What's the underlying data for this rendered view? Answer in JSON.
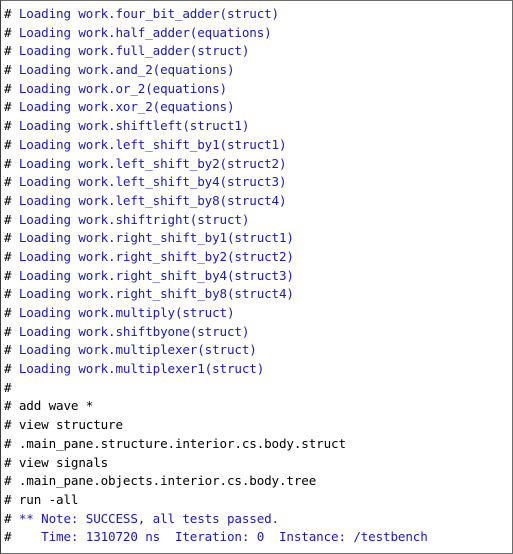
{
  "window": {
    "name": "Transcript"
  },
  "colors": {
    "loading_text": "#1a1ab4",
    "command_text": "#000000",
    "note_text": "#1a1ab4",
    "background": "#ffffff"
  },
  "transcript": {
    "lines": [
      {
        "prefix": "#",
        "text": " Loading work.four_bit_adder(struct)",
        "kind": "load"
      },
      {
        "prefix": "#",
        "text": " Loading work.half_adder(equations)",
        "kind": "load"
      },
      {
        "prefix": "#",
        "text": " Loading work.full_adder(struct)",
        "kind": "load"
      },
      {
        "prefix": "#",
        "text": " Loading work.and_2(equations)",
        "kind": "load"
      },
      {
        "prefix": "#",
        "text": " Loading work.or_2(equations)",
        "kind": "load"
      },
      {
        "prefix": "#",
        "text": " Loading work.xor_2(equations)",
        "kind": "load"
      },
      {
        "prefix": "#",
        "text": " Loading work.shiftleft(struct1)",
        "kind": "load"
      },
      {
        "prefix": "#",
        "text": " Loading work.left_shift_by1(struct1)",
        "kind": "load"
      },
      {
        "prefix": "#",
        "text": " Loading work.left_shift_by2(struct2)",
        "kind": "load"
      },
      {
        "prefix": "#",
        "text": " Loading work.left_shift_by4(struct3)",
        "kind": "load"
      },
      {
        "prefix": "#",
        "text": " Loading work.left_shift_by8(struct4)",
        "kind": "load"
      },
      {
        "prefix": "#",
        "text": " Loading work.shiftright(struct)",
        "kind": "load"
      },
      {
        "prefix": "#",
        "text": " Loading work.right_shift_by1(struct1)",
        "kind": "load"
      },
      {
        "prefix": "#",
        "text": " Loading work.right_shift_by2(struct2)",
        "kind": "load"
      },
      {
        "prefix": "#",
        "text": " Loading work.right_shift_by4(struct3)",
        "kind": "load"
      },
      {
        "prefix": "#",
        "text": " Loading work.right_shift_by8(struct4)",
        "kind": "load"
      },
      {
        "prefix": "#",
        "text": " Loading work.multiply(struct)",
        "kind": "load"
      },
      {
        "prefix": "#",
        "text": " Loading work.shiftbyone(struct)",
        "kind": "load"
      },
      {
        "prefix": "#",
        "text": " Loading work.multiplexer(struct)",
        "kind": "load"
      },
      {
        "prefix": "#",
        "text": " Loading work.multiplexer1(struct)",
        "kind": "load"
      },
      {
        "prefix": "#",
        "text": "",
        "kind": "cmd"
      },
      {
        "prefix": "#",
        "text": " add wave *",
        "kind": "cmd"
      },
      {
        "prefix": "#",
        "text": " view structure",
        "kind": "cmd"
      },
      {
        "prefix": "#",
        "text": " .main_pane.structure.interior.cs.body.struct",
        "kind": "cmd"
      },
      {
        "prefix": "#",
        "text": " view signals",
        "kind": "cmd"
      },
      {
        "prefix": "#",
        "text": " .main_pane.objects.interior.cs.body.tree",
        "kind": "cmd"
      },
      {
        "prefix": "#",
        "text": " run -all",
        "kind": "cmd"
      },
      {
        "prefix": "#",
        "text": " ** Note: SUCCESS, all tests passed.",
        "kind": "note"
      },
      {
        "prefix": "#",
        "text": "    Time: 1310720 ns  Iteration: 0  Instance: /testbench",
        "kind": "note"
      }
    ]
  }
}
